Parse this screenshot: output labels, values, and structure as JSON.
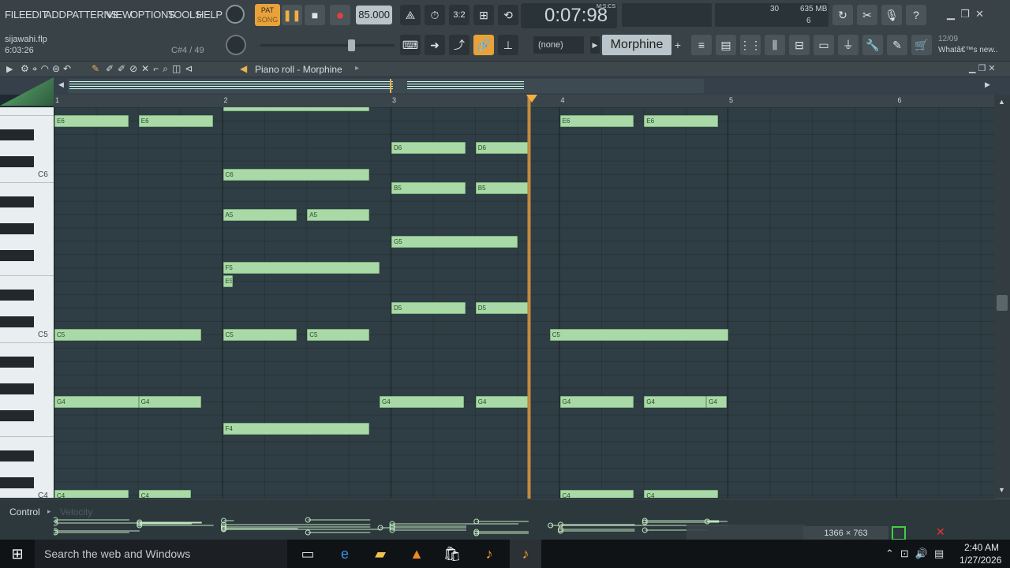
{
  "menu": [
    "FILE",
    "EDIT",
    "ADD",
    "PATTERNS",
    "VIEW",
    "OPTIONS",
    "TOOLS",
    "HELP"
  ],
  "transport": {
    "pat": "PAT",
    "song": "SONG",
    "tempo": "85.000",
    "time": "0:07:98",
    "time_format": "M:S:CS"
  },
  "meters": {
    "cpu": "30",
    "memory": "635 MB",
    "voices": "6"
  },
  "project": {
    "file": "sijawahi.flp",
    "duration": "6:03:26",
    "hint": "C#4 / 49"
  },
  "channel": {
    "selector": "(none)",
    "instrument": "Morphine"
  },
  "news": {
    "date": "12/09",
    "text": "Whatâ€™s new.."
  },
  "pianoroll": {
    "title": "Piano roll - Morphine"
  },
  "ruler": [
    "1",
    "2",
    "3",
    "4",
    "5",
    "6"
  ],
  "key_labels": [
    "C6",
    "C5",
    "C4"
  ],
  "notes": [
    {
      "n": "E6",
      "bar": 1.0,
      "len": 0.44
    },
    {
      "n": "E6",
      "bar": 1.5,
      "len": 0.44
    },
    {
      "n": "E6",
      "bar": 4.0,
      "len": 0.44
    },
    {
      "n": "E6",
      "bar": 4.5,
      "len": 0.44
    },
    {
      "n": "D6",
      "bar": 3.0,
      "len": 0.44
    },
    {
      "n": "D6",
      "bar": 3.5,
      "len": 0.31
    },
    {
      "n": "C6",
      "bar": 2.0,
      "len": 0.87
    },
    {
      "n": "B5",
      "bar": 3.0,
      "len": 0.44
    },
    {
      "n": "B5",
      "bar": 3.5,
      "len": 0.31
    },
    {
      "n": "A5",
      "bar": 2.0,
      "len": 0.44
    },
    {
      "n": "A5",
      "bar": 2.5,
      "len": 0.37
    },
    {
      "n": "G5",
      "bar": 3.0,
      "len": 0.75
    },
    {
      "n": "F5",
      "bar": 2.0,
      "len": 0.93
    },
    {
      "n": "E5",
      "bar": 2.0,
      "len": 0.06
    },
    {
      "n": "D5",
      "bar": 3.0,
      "len": 0.44
    },
    {
      "n": "D5",
      "bar": 3.5,
      "len": 0.31
    },
    {
      "n": "C5",
      "bar": 1.0,
      "len": 0.87
    },
    {
      "n": "C5",
      "bar": 2.0,
      "len": 0.44
    },
    {
      "n": "C5",
      "bar": 2.5,
      "len": 0.37
    },
    {
      "n": "C5",
      "bar": 3.94,
      "len": 1.06
    },
    {
      "n": "G4",
      "bar": 1.0,
      "len": 0.5
    },
    {
      "n": "G4",
      "bar": 1.5,
      "len": 0.37
    },
    {
      "n": "G4",
      "bar": 2.93,
      "len": 0.5
    },
    {
      "n": "G4",
      "bar": 3.5,
      "len": 0.31
    },
    {
      "n": "G4",
      "bar": 4.0,
      "len": 0.44
    },
    {
      "n": "G4",
      "bar": 4.5,
      "len": 0.37
    },
    {
      "n": "G4",
      "bar": 4.87,
      "len": 0.12
    },
    {
      "n": "F4",
      "bar": 2.0,
      "len": 0.87
    },
    {
      "n": "C4",
      "bar": 1.0,
      "len": 0.44
    },
    {
      "n": "C4",
      "bar": 1.5,
      "len": 0.31
    },
    {
      "n": "C4",
      "bar": 4.0,
      "len": 0.44
    },
    {
      "n": "C4",
      "bar": 4.5,
      "len": 0.44
    }
  ],
  "playhead_bar": 3.82,
  "control": {
    "label": "Control",
    "param": "Velocity"
  },
  "screen_overlay": "1366 × 763",
  "taskbar": {
    "search": "Search the web and Windows",
    "time": "2:40 AM",
    "date": "1/27/2026"
  }
}
